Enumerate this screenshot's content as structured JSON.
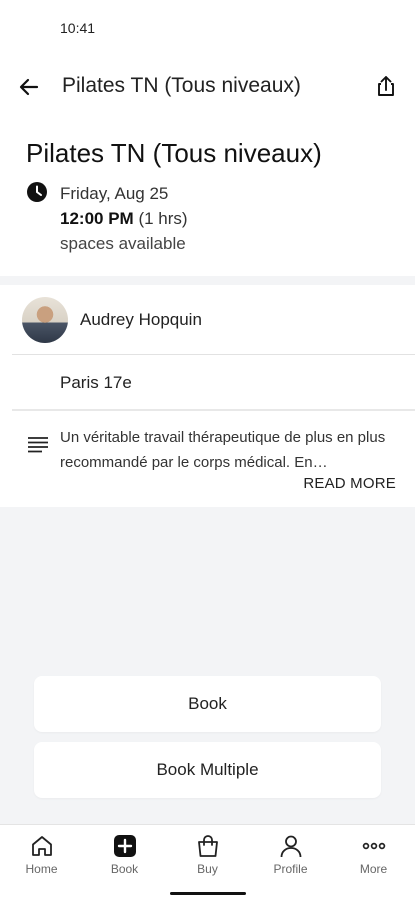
{
  "status_bar": {
    "time": "10:41"
  },
  "app_bar": {
    "title": "Pilates TN (Tous niveaux)",
    "back_icon": "arrow-left-icon",
    "share_icon": "share-icon"
  },
  "class": {
    "title": "Pilates TN (Tous niveaux)",
    "date": "Friday, Aug 25",
    "time": "12:00 PM",
    "duration": "(1 hrs)",
    "spaces": "spaces available"
  },
  "instructor": {
    "name": "Audrey Hopquin"
  },
  "location": {
    "name": "Paris 17e"
  },
  "description": {
    "text": "Un véritable travail thérapeutique de plus en plus recommandé par le corps médical. En…",
    "read_more": "READ MORE"
  },
  "actions": {
    "book": "Book",
    "book_multiple": "Book Multiple"
  },
  "nav": {
    "items": [
      {
        "label": "Home",
        "icon": "home-icon"
      },
      {
        "label": "Book",
        "icon": "plus-square-icon"
      },
      {
        "label": "Buy",
        "icon": "shopping-bag-icon"
      },
      {
        "label": "Profile",
        "icon": "user-icon"
      },
      {
        "label": "More",
        "icon": "more-dots-icon"
      }
    ]
  }
}
